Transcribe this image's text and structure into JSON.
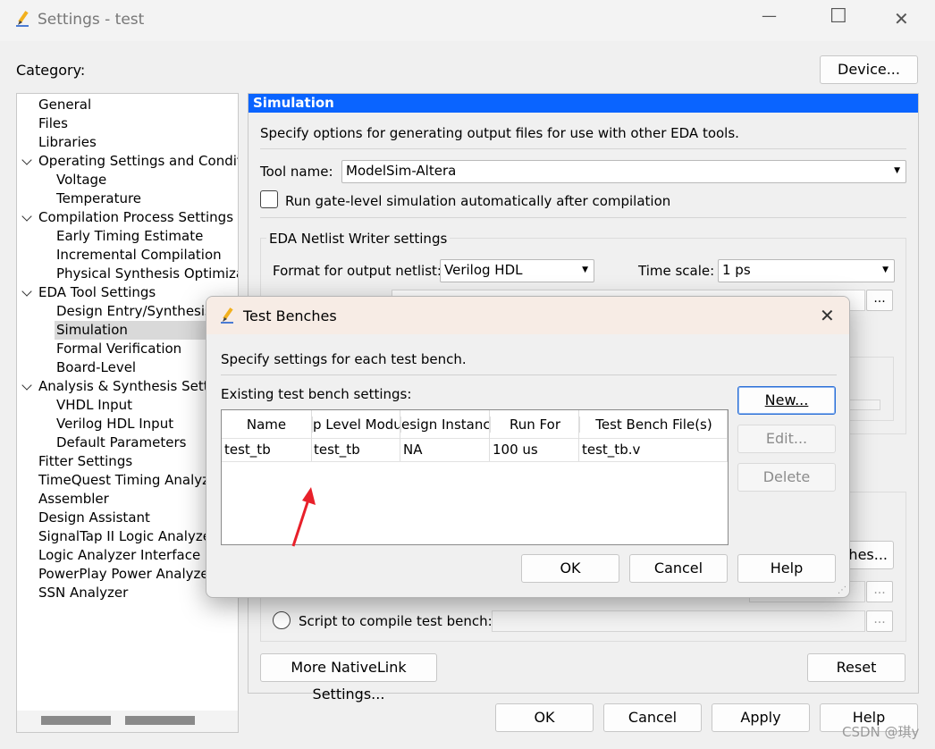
{
  "window": {
    "title": "Settings - test",
    "controls": {
      "minimize": "—",
      "maximize": "☐",
      "close": "✕"
    }
  },
  "category_label": "Category:",
  "device_button": "Device...",
  "tree": [
    {
      "label": "General",
      "level": 0
    },
    {
      "label": "Files",
      "level": 0
    },
    {
      "label": "Libraries",
      "level": 0
    },
    {
      "label": "Operating Settings and Conditic",
      "level": 0,
      "expanded": true
    },
    {
      "label": "Voltage",
      "level": 1
    },
    {
      "label": "Temperature",
      "level": 1
    },
    {
      "label": "Compilation Process Settings",
      "level": 0,
      "expanded": true
    },
    {
      "label": "Early Timing Estimate",
      "level": 1
    },
    {
      "label": "Incremental Compilation",
      "level": 1
    },
    {
      "label": "Physical Synthesis Optimizati",
      "level": 1
    },
    {
      "label": "EDA Tool Settings",
      "level": 0,
      "expanded": true
    },
    {
      "label": "Design Entry/Synthesis",
      "level": 1
    },
    {
      "label": "Simulation",
      "level": 1,
      "selected": true
    },
    {
      "label": "Formal Verification",
      "level": 1
    },
    {
      "label": "Board-Level",
      "level": 1
    },
    {
      "label": "Analysis & Synthesis Settin",
      "level": 0,
      "expanded": true
    },
    {
      "label": "VHDL Input",
      "level": 1
    },
    {
      "label": "Verilog HDL Input",
      "level": 1
    },
    {
      "label": "Default Parameters",
      "level": 1
    },
    {
      "label": "Fitter Settings",
      "level": 0
    },
    {
      "label": "TimeQuest Timing Analyz",
      "level": 0
    },
    {
      "label": "Assembler",
      "level": 0
    },
    {
      "label": "Design Assistant",
      "level": 0
    },
    {
      "label": "SignalTap II Logic Analyze",
      "level": 0
    },
    {
      "label": "Logic Analyzer Interface",
      "level": 0
    },
    {
      "label": "PowerPlay Power Analyzer",
      "level": 0
    },
    {
      "label": "SSN Analyzer",
      "level": 0
    }
  ],
  "panel": {
    "header": "Simulation",
    "description": "Specify options for generating output files for use with other EDA tools.",
    "tool_name_label": "Tool name:",
    "tool_name_value": "ModelSim-Altera",
    "run_gate_level": "Run gate-level simulation automatically after compilation",
    "netlist_group": "EDA Netlist Writer settings",
    "format_label": "Format for output netlist:",
    "format_value": "Verilog HDL",
    "timescale_label": "Time scale:",
    "timescale_value": "1 ps",
    "browse": "...",
    "test_benches_btn_partial": "ches...",
    "script_label": "Script to compile test bench:",
    "more_nativelink": "More NativeLink Settings...",
    "reset": "Reset"
  },
  "footer": {
    "ok": "OK",
    "cancel": "Cancel",
    "apply": "Apply",
    "help": "Help"
  },
  "dialog": {
    "title": "Test Benches",
    "close": "✕",
    "description": "Specify settings for each test bench.",
    "existing_label": "Existing test bench settings:",
    "columns": [
      "Name",
      "p Level Modu",
      "esign Instanc",
      "Run For",
      "Test Bench File(s)"
    ],
    "rows": [
      [
        "test_tb",
        "test_tb",
        "NA",
        "100 us",
        "test_tb.v"
      ]
    ],
    "new": "New...",
    "edit": "Edit...",
    "delete": "Delete",
    "ok": "OK",
    "cancel": "Cancel",
    "help": "Help"
  },
  "watermark": "CSDN @琪y",
  "colors": {
    "selection": "#0a64ff",
    "arrow": "#e8202a"
  }
}
